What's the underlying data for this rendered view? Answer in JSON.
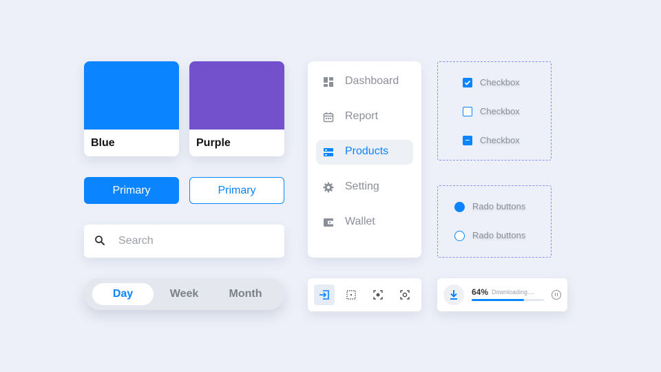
{
  "swatches": [
    {
      "label": "Blue",
      "color": "#0a84ff"
    },
    {
      "label": "Purple",
      "color": "#7451cc"
    }
  ],
  "buttons": {
    "primary_solid": "Primary",
    "primary_outline": "Primary"
  },
  "search": {
    "placeholder": "Search",
    "icon": "search-icon"
  },
  "segment": {
    "options": [
      "Day",
      "Week",
      "Month"
    ],
    "selected": "Day"
  },
  "menu": {
    "items": [
      {
        "label": "Dashboard",
        "icon": "dashboard-icon"
      },
      {
        "label": "Report",
        "icon": "calendar-icon"
      },
      {
        "label": "Products",
        "icon": "server-icon",
        "active": true
      },
      {
        "label": "Setting",
        "icon": "gear-icon"
      },
      {
        "label": "Wallet",
        "icon": "wallet-icon"
      }
    ]
  },
  "checkboxes": [
    {
      "label": "Checkbox",
      "state": "checked"
    },
    {
      "label": "Checkbox",
      "state": "unchecked"
    },
    {
      "label": "Checkbox",
      "state": "indeterminate"
    }
  ],
  "radios": [
    {
      "label": "Rado buttons",
      "selected": true
    },
    {
      "label": "Rado buttons",
      "selected": false
    }
  ],
  "toolbar": {
    "tools": [
      "input-icon",
      "dotted-square-icon",
      "focus-icon",
      "focus-ring-icon"
    ],
    "active": "input-icon"
  },
  "download": {
    "percent_text": "64%",
    "status": "Downloading....",
    "progress": 0.72
  },
  "colors": {
    "accent": "#0a84ff",
    "background": "#edf0f8",
    "muted_text": "#8a8f98"
  }
}
